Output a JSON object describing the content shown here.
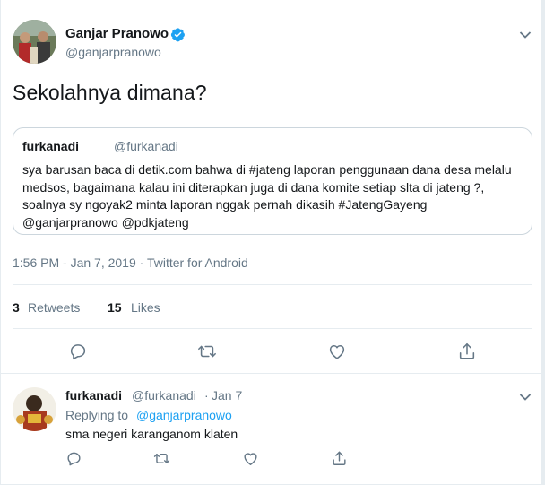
{
  "tweet": {
    "author_name": "Ganjar Pranowo",
    "author_handle": "@ganjarpranowo",
    "text": "Sekolahnya dimana?",
    "timestamp": "1:56 PM - Jan 7, 2019 · Twitter for Android",
    "retweets_count": "3",
    "retweets_label": "Retweets",
    "likes_count": "15",
    "likes_label": "Likes"
  },
  "quoted_tweet": {
    "author_name": "furkanadi",
    "author_handle": "@furkanadi",
    "text": "sya barusan baca di detik.com bahwa di #jateng laporan penggunaan dana desa melalu medsos, bagaimana kalau ini diterapkan juga di dana komite setiap slta di jateng ?, soalnya sy ngoyak2 minta laporan nggak pernah dikasih  #JatengGayeng @ganjarpranowo @pdkjateng"
  },
  "reply": {
    "author_name": "furkanadi",
    "author_handle": "@furkanadi",
    "dot": "·",
    "date": "Jan 7",
    "replying_label": "Replying to",
    "replying_to": "@ganjarpranowo",
    "text": "sma negeri karanganom klaten"
  },
  "colors": {
    "text_primary": "#14171a",
    "text_secondary": "#657786",
    "accent": "#1da1f2",
    "divider": "#e6ecf0"
  },
  "icons": [
    "verified-badge-icon",
    "chevron-down-icon",
    "reply-icon",
    "retweet-icon",
    "like-icon",
    "share-icon"
  ]
}
